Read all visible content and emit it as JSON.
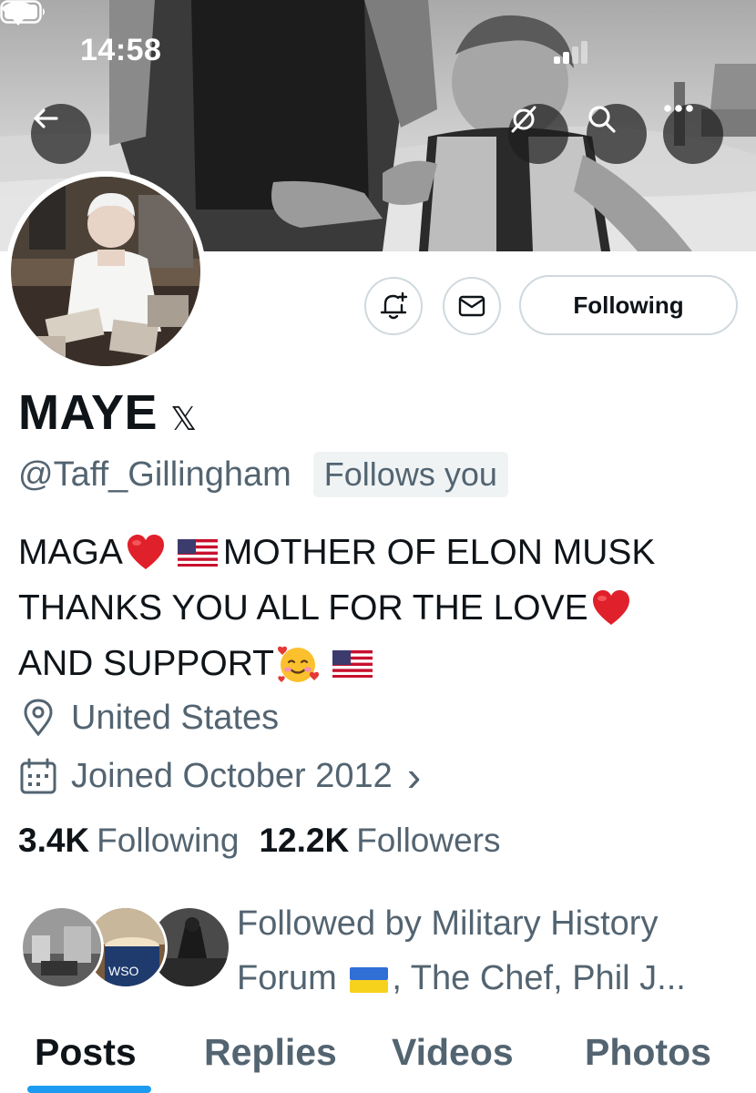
{
  "status_bar": {
    "time": "14:58"
  },
  "profile": {
    "name": "MAYE",
    "verified_badge": "𝕏",
    "handle": "@Taff_Gillingham",
    "follows_you": "Follows you",
    "bio": {
      "line1_a": "MAGA",
      "line1_b": "MOTHER OF ELON MUSK",
      "line2": "THANKS YOU ALL FOR THE LOVE",
      "line3": "AND SUPPORT"
    },
    "location": "United States",
    "joined": "Joined October 2012",
    "joined_chevron": "›",
    "stats": {
      "following_count": "3.4K",
      "following_label": "Following",
      "followers_count": "12.2K",
      "followers_label": "Followers"
    },
    "followed_by": {
      "line1": "Followed by Military History",
      "line2_a": "Forum",
      "line2_b": ", The Chef, Phil J..."
    }
  },
  "actions": {
    "following_button": "Following"
  },
  "tabs": [
    {
      "label": "Posts",
      "active": true
    },
    {
      "label": "Replies",
      "active": false
    },
    {
      "label": "Videos",
      "active": false
    },
    {
      "label": "Photos",
      "active": false
    }
  ],
  "icons": {
    "back": "arrow-left-icon",
    "grok": "grok-icon",
    "search": "search-icon",
    "more": "more-icon",
    "notify": "bell-plus-icon",
    "message": "envelope-icon",
    "location": "location-pin-icon",
    "calendar": "calendar-icon"
  },
  "colors": {
    "accent": "#1d9bf0",
    "text_primary": "#0f1419",
    "text_secondary": "#536471",
    "border": "#cfd9de"
  }
}
